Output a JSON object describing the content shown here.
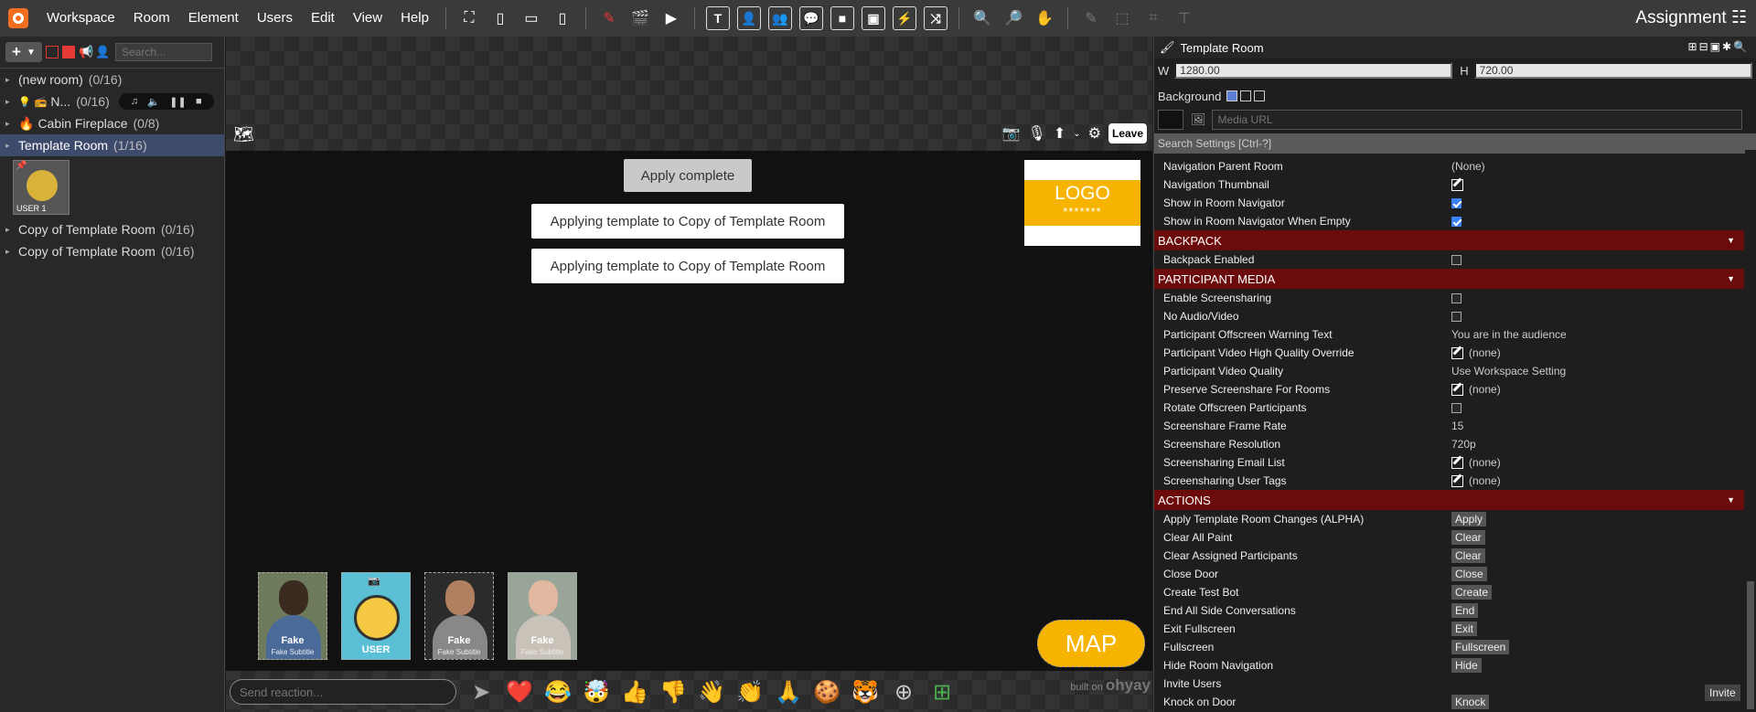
{
  "menubar": {
    "menus": [
      "Workspace",
      "Room",
      "Element",
      "Users",
      "Edit",
      "View",
      "Help"
    ],
    "assignment_label": "Assignment"
  },
  "sidebar": {
    "search_placeholder": "Search...",
    "rooms": [
      {
        "name": "(new room)",
        "count": "(0/16)"
      },
      {
        "name": "N...",
        "count": "(0/16)"
      },
      {
        "name": "Cabin Fireplace",
        "count": "(0/8)"
      },
      {
        "name": "Template Room",
        "count": "(1/16)"
      },
      {
        "name": "Copy of Template Room",
        "count": "(0/16)"
      },
      {
        "name": "Copy of Template Room",
        "count": "(0/16)"
      }
    ],
    "user_tile_label": "USER 1"
  },
  "stage": {
    "leave_label": "Leave",
    "toasts": {
      "apply_complete": "Apply complete",
      "applying_1": "Applying template to Copy of Template Room",
      "applying_2": "Applying template to Copy of Template Room"
    },
    "logo": {
      "title": "LOGO",
      "stars": "*******"
    },
    "tiles": [
      {
        "name": "Fake",
        "sub": "Fake Subtitle"
      },
      {
        "name": "USER",
        "sub": ""
      },
      {
        "name": "Fake",
        "sub": "Fake Subtitle"
      },
      {
        "name": "Fake",
        "sub": "Fake Subtitle"
      }
    ],
    "map_label": "MAP",
    "reaction_placeholder": "Send reaction...",
    "built_on": "built on",
    "brand": "ohyay"
  },
  "props": {
    "title": "Template Room",
    "w_label": "W",
    "w_value": "1280.00",
    "h_label": "H",
    "h_value": "720.00",
    "background_label": "Background",
    "media_url_placeholder": "Media URL",
    "search_settings": "Search Settings [Ctrl-?]",
    "rows_a": [
      {
        "k": "Navigation Parent Room",
        "v": "(None)"
      },
      {
        "k": "Navigation Thumbnail",
        "v": ""
      },
      {
        "k": "Show in Room Navigator",
        "v": ""
      },
      {
        "k": "Show in Room Navigator When Empty",
        "v": ""
      }
    ],
    "section_backpack": "BACKPACK",
    "backpack_enabled": "Backpack Enabled",
    "section_media": "PARTICIPANT MEDIA",
    "rows_media": [
      {
        "k": "Enable Screensharing",
        "v": ""
      },
      {
        "k": "No Audio/Video",
        "v": ""
      },
      {
        "k": "Participant Offscreen Warning Text",
        "v": "You are in the audience"
      },
      {
        "k": "Participant Video High Quality Override",
        "v": "(none)"
      },
      {
        "k": "Participant Video Quality",
        "v": "Use Workspace Setting"
      },
      {
        "k": "Preserve Screenshare For Rooms",
        "v": "(none)"
      },
      {
        "k": "Rotate Offscreen Participants",
        "v": ""
      },
      {
        "k": "Screenshare Frame Rate",
        "v": "15"
      },
      {
        "k": "Screenshare Resolution",
        "v": "720p"
      },
      {
        "k": "Screensharing Email List",
        "v": "(none)"
      },
      {
        "k": "Screensharing User Tags",
        "v": "(none)"
      }
    ],
    "section_actions": "ACTIONS",
    "actions": [
      {
        "k": "Apply Template Room Changes (ALPHA)",
        "v": "Apply"
      },
      {
        "k": "Clear All Paint",
        "v": "Clear"
      },
      {
        "k": "Clear Assigned Participants",
        "v": "Clear"
      },
      {
        "k": "Close Door",
        "v": "Close"
      },
      {
        "k": "Create Test Bot",
        "v": "Create"
      },
      {
        "k": "End All Side Conversations",
        "v": "End"
      },
      {
        "k": "Exit Fullscreen",
        "v": "Exit"
      },
      {
        "k": "Fullscreen",
        "v": "Fullscreen"
      },
      {
        "k": "Hide Room Navigation",
        "v": "Hide"
      },
      {
        "k": "Invite Users",
        "v": ""
      },
      {
        "k": "Knock on Door",
        "v": "Knock"
      }
    ],
    "invite_label": "Invite"
  },
  "colors": {
    "accent": "#f6b400",
    "section": "#6b0b0b",
    "selected_room": "#3d4a6b"
  }
}
